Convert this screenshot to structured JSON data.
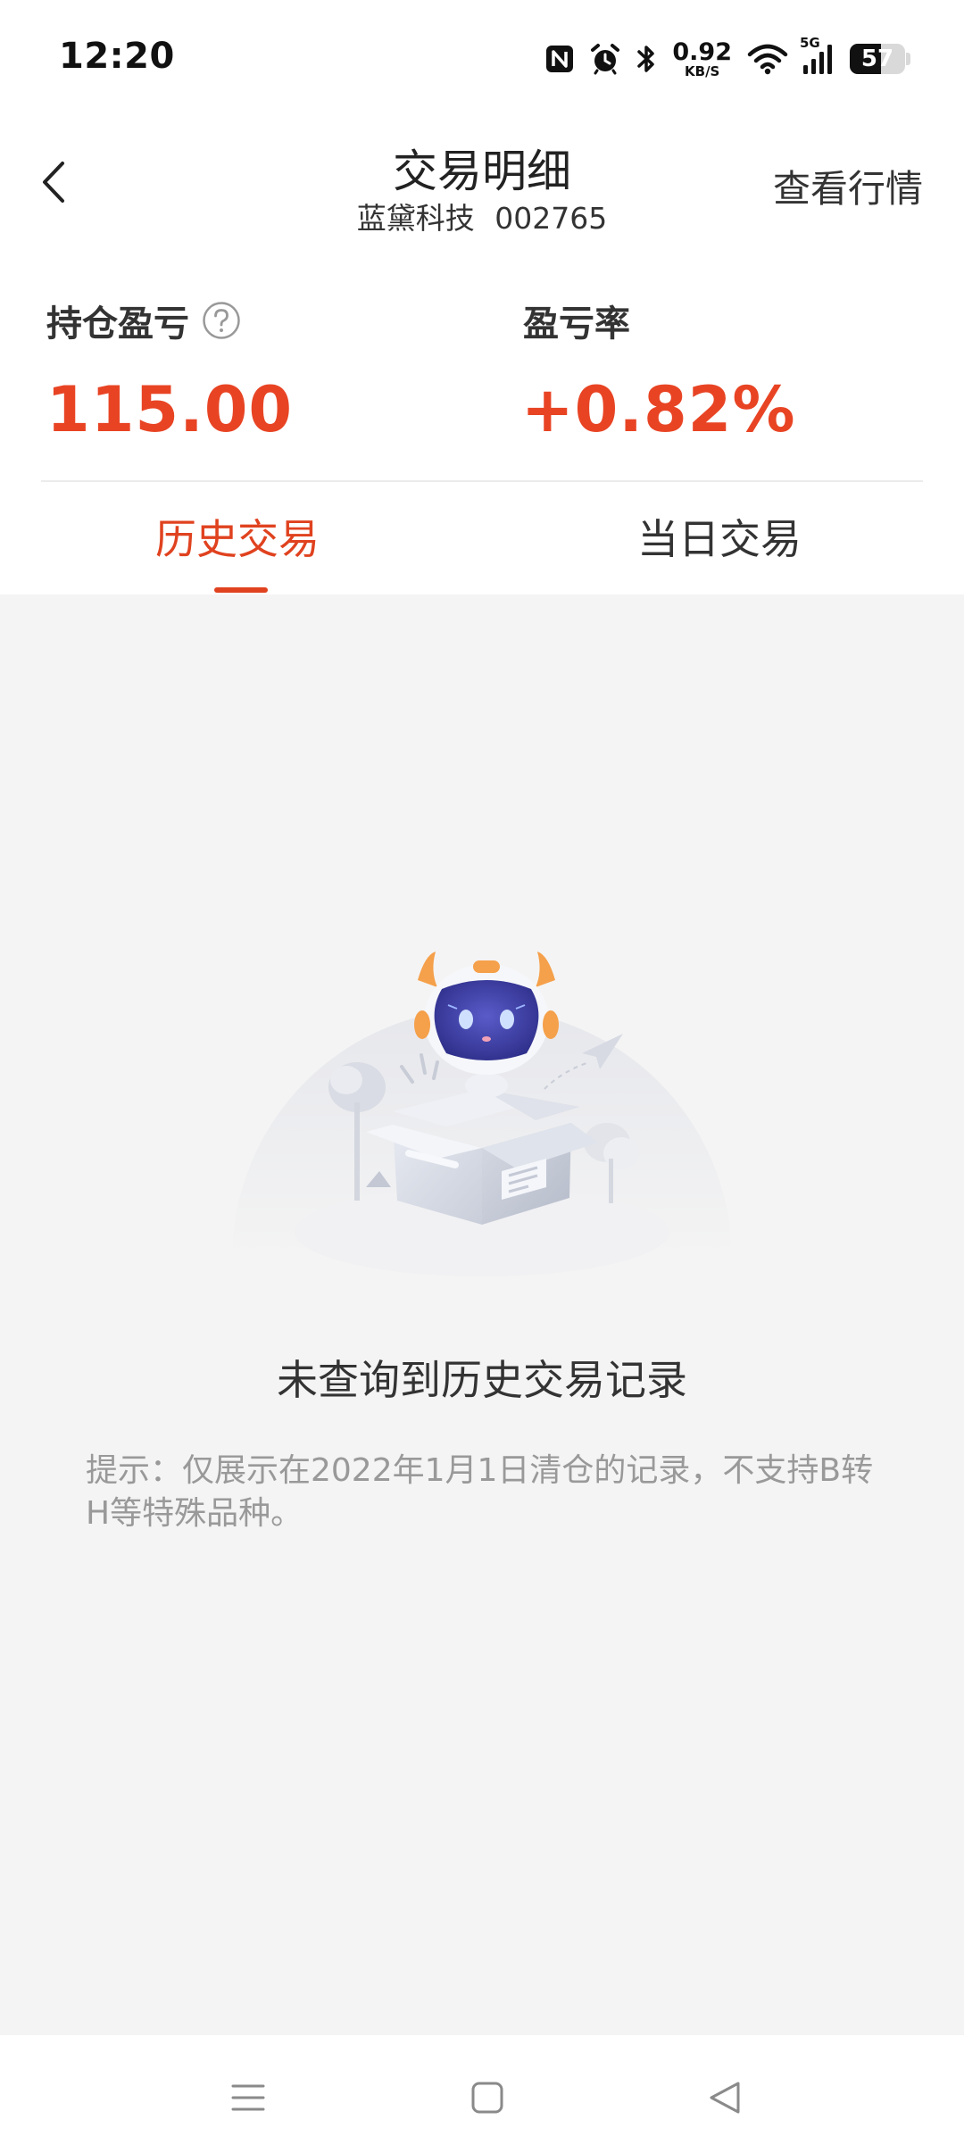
{
  "status_bar": {
    "time": "12:20",
    "net_speed_value": "0.92",
    "net_speed_unit": "KB/S",
    "network_type": "5G",
    "battery_level": "57",
    "icons": [
      "nfc-icon",
      "alarm-icon",
      "bluetooth-icon",
      "wifi-icon",
      "signal-icon",
      "battery-icon"
    ]
  },
  "header": {
    "title": "交易明细",
    "stock_name": "蓝黛科技",
    "stock_code": "002765",
    "action_label": "查看行情"
  },
  "summary": {
    "pl_label": "持仓盈亏",
    "pl_value": "115.00",
    "rate_label": "盈亏率",
    "rate_value": "+0.82%",
    "value_color": "#e84424"
  },
  "tabs": [
    {
      "label": "历史交易",
      "active": true
    },
    {
      "label": "当日交易",
      "active": false
    }
  ],
  "empty_state": {
    "title": "未查询到历史交易记录",
    "hint": "提示：仅展示在2022年1月1日清仓的记录，不支持B转H等特殊品种。"
  },
  "colors": {
    "accent": "#e0421f",
    "background": "#f4f4f4"
  }
}
